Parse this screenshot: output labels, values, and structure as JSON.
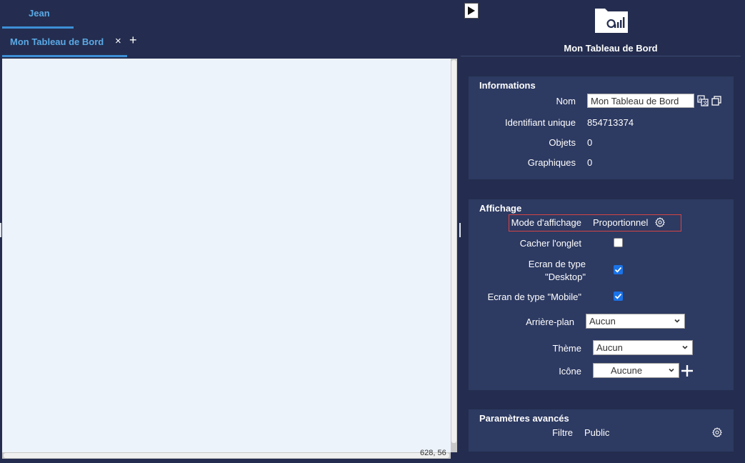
{
  "left": {
    "user_tab": "Jean",
    "dashboard_tab": "Mon Tableau de Bord",
    "close_symbol": "×",
    "add_symbol": "+",
    "coords": "628, 56"
  },
  "right": {
    "title": "Mon Tableau de Bord",
    "informations": {
      "title": "Informations",
      "nom_label": "Nom",
      "nom_value": "Mon Tableau de Bord",
      "id_label": "Identifiant unique",
      "id_value": "854713374",
      "objets_label": "Objets",
      "objets_value": "0",
      "graphiques_label": "Graphiques",
      "graphiques_value": "0"
    },
    "affichage": {
      "title": "Affichage",
      "mode_label": "Mode d'affichage",
      "mode_value": "Proportionnel",
      "cacher_label": "Cacher l'onglet",
      "desktop_label_1": "Ecran de type",
      "desktop_label_2": "\"Desktop\"",
      "mobile_label": "Ecran de type \"Mobile\"",
      "arriere_label": "Arrière-plan",
      "arriere_value": "Aucun",
      "theme_label": "Thème",
      "theme_value": "Aucun",
      "icone_label": "Icône",
      "icone_value": "Aucune",
      "cacher_checked": false,
      "desktop_checked": true,
      "mobile_checked": true
    },
    "avances": {
      "title": "Paramètres avancés",
      "filtre_label": "Filtre",
      "filtre_value": "Public"
    }
  },
  "colors": {
    "background": "#242d4f",
    "panel": "#2d3a62",
    "accent": "#3d8fd6",
    "canvas": "#edf3fb",
    "highlight_border": "#d64545"
  },
  "icons": [
    "play-icon",
    "dashboard-folder-icon",
    "translate-icon",
    "copy-icon",
    "gear-icon",
    "plus-icon",
    "chevron-down-icon",
    "checkmark-icon"
  ]
}
